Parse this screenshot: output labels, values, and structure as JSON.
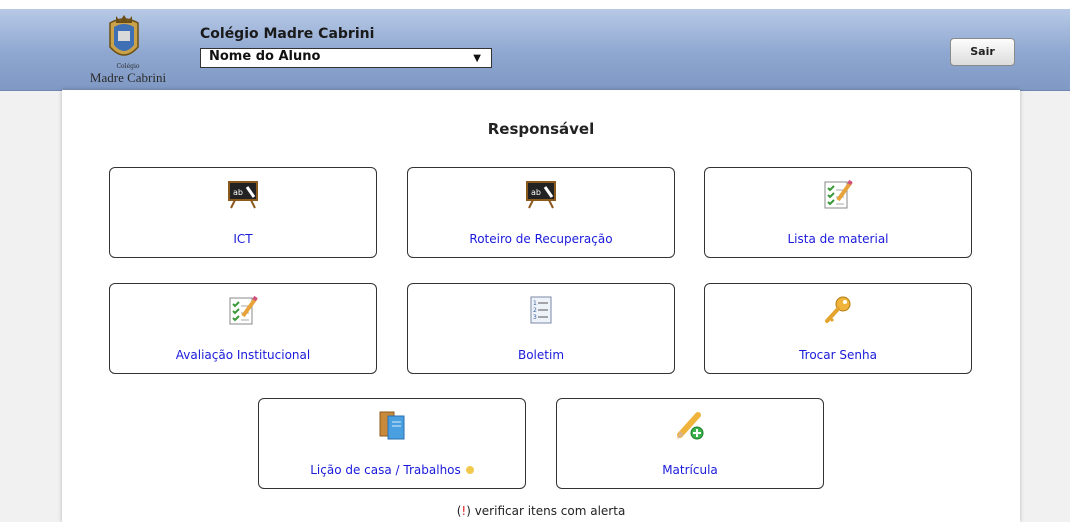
{
  "header": {
    "logo_small_text": "Colégio",
    "logo_name": "Madre Cabrini",
    "school_name": "Colégio Madre Cabrini",
    "student_select": {
      "selected": "Nome do Aluno"
    },
    "logout_label": "Sair"
  },
  "main": {
    "title": "Responsável",
    "tiles": [
      {
        "label": "ICT",
        "icon": "chalkboard-icon"
      },
      {
        "label": "Roteiro de Recuperação",
        "icon": "chalkboard-icon"
      },
      {
        "label": "Lista de material",
        "icon": "checklist-pencil-icon"
      },
      {
        "label": "Avaliação Institucional",
        "icon": "checklist-pencil-icon"
      },
      {
        "label": "Boletim",
        "icon": "report-list-icon"
      },
      {
        "label": "Trocar Senha",
        "icon": "key-icon"
      },
      {
        "label": "Lição de casa / Trabalhos",
        "icon": "books-icon",
        "alert": true,
        "alert_color": "#f2c94c"
      },
      {
        "label": "Matrícula",
        "icon": "pencil-add-icon"
      }
    ],
    "alert_note": {
      "open": "(",
      "mark": "!",
      "close": ")",
      "text": " verificar itens com alerta"
    }
  },
  "colors": {
    "header": "#8ea7d0",
    "link": "#1a1adb",
    "alert_dot": "#f2c94c",
    "alert_mark": "#e02020"
  }
}
